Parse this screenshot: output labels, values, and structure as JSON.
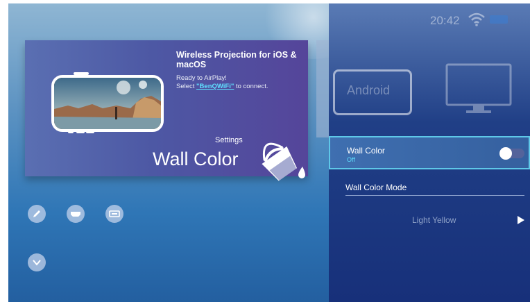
{
  "card": {
    "title": "Wireless Projection for iOS & macOS",
    "subtitle_line1": "Ready to AirPlay!",
    "subtitle_prefix": "Select ",
    "subtitle_link": "\"BenQWiFi\"",
    "subtitle_suffix": " to connect."
  },
  "overlay": {
    "settings_label": "Settings",
    "setting_name": "Wall Color"
  },
  "status": {
    "time": "20:42"
  },
  "tiles": {
    "android_label": "Android"
  },
  "panel": {
    "wall_color": {
      "label": "Wall Color",
      "value": "Off"
    },
    "wall_color_mode": {
      "label": "Wall Color Mode"
    },
    "mode_option": {
      "label": "Light Yellow"
    }
  },
  "colors": {
    "accent": "#5fe0ff",
    "focus_border": "#5ec8e8"
  }
}
